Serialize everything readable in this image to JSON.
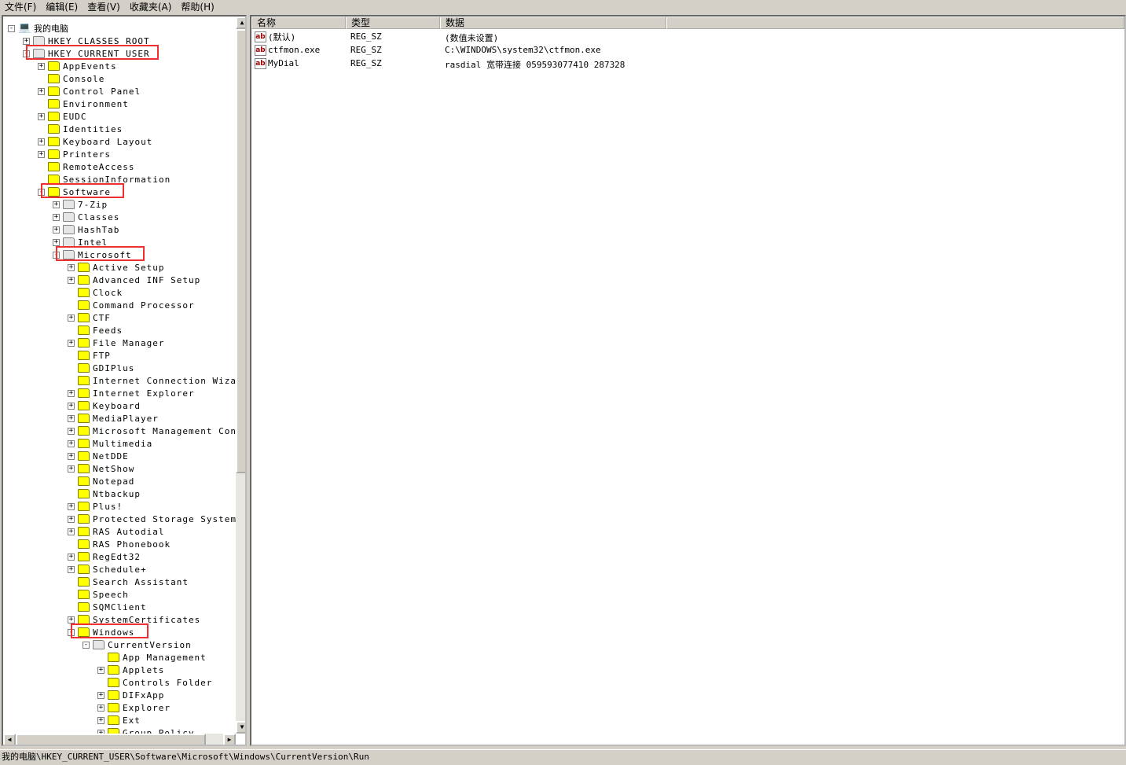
{
  "menu": [
    "文件(F)",
    "编辑(E)",
    "查看(V)",
    "收藏夹(A)",
    "帮助(H)"
  ],
  "tree": [
    {
      "label": "我的电脑",
      "level": 0,
      "exp": "-",
      "icon": "computer"
    },
    {
      "label": "HKEY_CLASSES_ROOT",
      "level": 1,
      "exp": "+",
      "icon": "grey"
    },
    {
      "label": "HKEY_CURRENT_USER",
      "level": 1,
      "exp": "-",
      "icon": "grey",
      "highlight": true
    },
    {
      "label": "AppEvents",
      "level": 2,
      "exp": "+"
    },
    {
      "label": "Console",
      "level": 2,
      "exp": ""
    },
    {
      "label": "Control Panel",
      "level": 2,
      "exp": "+"
    },
    {
      "label": "Environment",
      "level": 2,
      "exp": ""
    },
    {
      "label": "EUDC",
      "level": 2,
      "exp": "+"
    },
    {
      "label": "Identities",
      "level": 2,
      "exp": ""
    },
    {
      "label": "Keyboard Layout",
      "level": 2,
      "exp": "+"
    },
    {
      "label": "Printers",
      "level": 2,
      "exp": "+"
    },
    {
      "label": "RemoteAccess",
      "level": 2,
      "exp": ""
    },
    {
      "label": "SessionInformation",
      "level": 2,
      "exp": ""
    },
    {
      "label": "Software",
      "level": 2,
      "exp": "-",
      "highlight": true
    },
    {
      "label": "7-Zip",
      "level": 3,
      "exp": "+",
      "icon": "grey"
    },
    {
      "label": "Classes",
      "level": 3,
      "exp": "+",
      "icon": "grey"
    },
    {
      "label": "HashTab",
      "level": 3,
      "exp": "+",
      "icon": "grey"
    },
    {
      "label": "Intel",
      "level": 3,
      "exp": "+",
      "icon": "grey"
    },
    {
      "label": "Microsoft",
      "level": 3,
      "exp": "-",
      "icon": "grey",
      "highlight": true
    },
    {
      "label": "Active Setup",
      "level": 4,
      "exp": "+"
    },
    {
      "label": "Advanced INF Setup",
      "level": 4,
      "exp": "+"
    },
    {
      "label": "Clock",
      "level": 4,
      "exp": ""
    },
    {
      "label": "Command Processor",
      "level": 4,
      "exp": ""
    },
    {
      "label": "CTF",
      "level": 4,
      "exp": "+"
    },
    {
      "label": "Feeds",
      "level": 4,
      "exp": ""
    },
    {
      "label": "File Manager",
      "level": 4,
      "exp": "+"
    },
    {
      "label": "FTP",
      "level": 4,
      "exp": ""
    },
    {
      "label": "GDIPlus",
      "level": 4,
      "exp": ""
    },
    {
      "label": "Internet Connection Wizard",
      "level": 4,
      "exp": ""
    },
    {
      "label": "Internet Explorer",
      "level": 4,
      "exp": "+"
    },
    {
      "label": "Keyboard",
      "level": 4,
      "exp": "+"
    },
    {
      "label": "MediaPlayer",
      "level": 4,
      "exp": "+"
    },
    {
      "label": "Microsoft Management Console",
      "level": 4,
      "exp": "+"
    },
    {
      "label": "Multimedia",
      "level": 4,
      "exp": "+"
    },
    {
      "label": "NetDDE",
      "level": 4,
      "exp": "+"
    },
    {
      "label": "NetShow",
      "level": 4,
      "exp": "+"
    },
    {
      "label": "Notepad",
      "level": 4,
      "exp": ""
    },
    {
      "label": "Ntbackup",
      "level": 4,
      "exp": ""
    },
    {
      "label": "Plus!",
      "level": 4,
      "exp": "+"
    },
    {
      "label": "Protected Storage System Prov:",
      "level": 4,
      "exp": "+"
    },
    {
      "label": "RAS Autodial",
      "level": 4,
      "exp": "+"
    },
    {
      "label": "RAS Phonebook",
      "level": 4,
      "exp": ""
    },
    {
      "label": "RegEdt32",
      "level": 4,
      "exp": "+"
    },
    {
      "label": "Schedule+",
      "level": 4,
      "exp": "+"
    },
    {
      "label": "Search Assistant",
      "level": 4,
      "exp": ""
    },
    {
      "label": "Speech",
      "level": 4,
      "exp": ""
    },
    {
      "label": "SQMClient",
      "level": 4,
      "exp": ""
    },
    {
      "label": "SystemCertificates",
      "level": 4,
      "exp": "+"
    },
    {
      "label": "Windows",
      "level": 4,
      "exp": "-",
      "highlight": true
    },
    {
      "label": "CurrentVersion",
      "level": 5,
      "exp": "-",
      "icon": "grey"
    },
    {
      "label": "App Management",
      "level": 6,
      "exp": ""
    },
    {
      "label": "Applets",
      "level": 6,
      "exp": "+"
    },
    {
      "label": "Controls Folder",
      "level": 6,
      "exp": ""
    },
    {
      "label": "DIFxApp",
      "level": 6,
      "exp": "+"
    },
    {
      "label": "Explorer",
      "level": 6,
      "exp": "+"
    },
    {
      "label": "Ext",
      "level": 6,
      "exp": "+"
    },
    {
      "label": "Group Policy",
      "level": 6,
      "exp": "+"
    }
  ],
  "list": {
    "columns": [
      "名称",
      "类型",
      "数据"
    ],
    "rows": [
      {
        "name": "(默认)",
        "type": "REG_SZ",
        "data": "(数值未设置)",
        "icon": "ab"
      },
      {
        "name": "ctfmon.exe",
        "type": "REG_SZ",
        "data": "C:\\WINDOWS\\system32\\ctfmon.exe",
        "icon": "ab"
      },
      {
        "name": "MyDial",
        "type": "REG_SZ",
        "data": "rasdial 宽带连接 059593077410 287328",
        "icon": "ab"
      }
    ]
  },
  "status": "我的电脑\\HKEY_CURRENT_USER\\Software\\Microsoft\\Windows\\CurrentVersion\\Run",
  "highlight_color": "#f03030"
}
